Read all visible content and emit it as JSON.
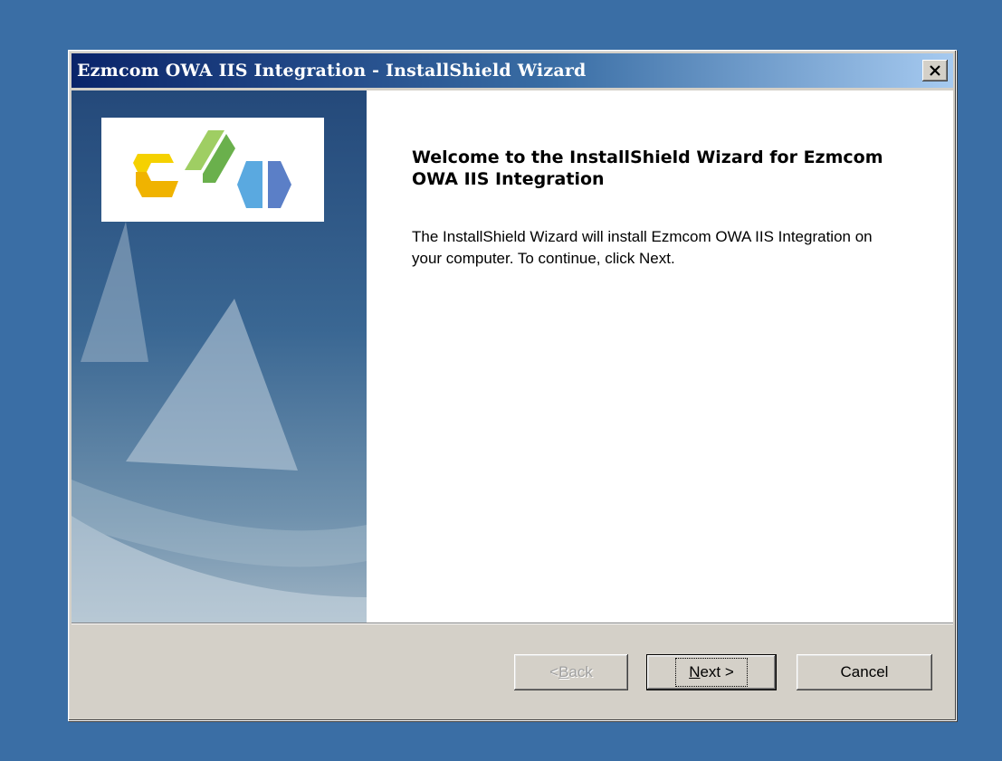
{
  "window": {
    "title": "Ezmcom OWA IIS Integration - InstallShield Wizard",
    "close_glyph": "✕"
  },
  "welcome": {
    "title": "Welcome to the InstallShield Wizard for Ezmcom OWA IIS Integration",
    "body": "The InstallShield Wizard will install Ezmcom OWA IIS Integration on your computer.  To continue, click Next."
  },
  "buttons": {
    "back_prefix": "< ",
    "back_mnemonic": "B",
    "back_rest": "ack",
    "next_mnemonic": "N",
    "next_rest": "ext >",
    "cancel": "Cancel"
  },
  "colors": {
    "desktop": "#3a6ea5",
    "titlebar_start": "#0a246a",
    "titlebar_end": "#a6caf0",
    "logo_yellow": "#f2c500",
    "logo_green": "#8cc63f",
    "logo_blue": "#4a90d9"
  }
}
